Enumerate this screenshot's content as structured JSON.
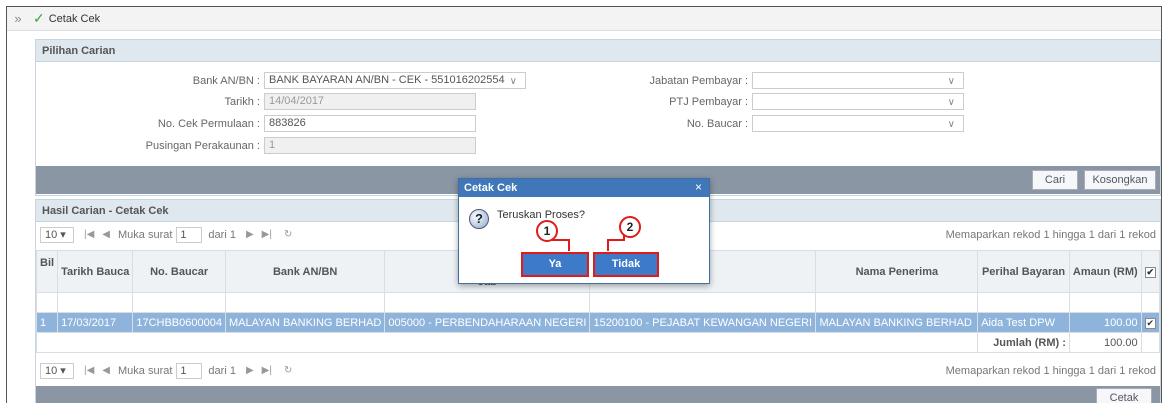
{
  "window": {
    "collapse_glyph": "»",
    "title": "Cetak Cek"
  },
  "search_panel": {
    "title": "Pilihan Carian",
    "bank_label": "Bank AN/BN :",
    "bank_value": "BANK BAYARAN AN/BN - CEK - 551016202554",
    "date_label": "Tarikh :",
    "date_value": "14/04/2017",
    "cheque_start_label": "No. Cek Permulaan :",
    "cheque_start_value": "883826",
    "cycle_label": "Pusingan Perakaunan :",
    "cycle_value": "1",
    "dept_label": "Jabatan Pembayar :",
    "dept_value": "",
    "ptj_label": "PTJ Pembayar :",
    "ptj_value": "",
    "voucher_label": "No. Baucar :",
    "voucher_value": "",
    "search_button": "Cari",
    "clear_button": "Kosongkan"
  },
  "results_panel": {
    "title": "Hasil Carian - Cetak Cek",
    "pager": {
      "page_size": "10",
      "page_label": "Muka surat",
      "page_value": "1",
      "of_label": "dari 1",
      "record_info": "Memaparkan rekod 1 hingga 1 dari 1 rekod"
    },
    "columns": [
      "Bil",
      "Tarikh Bauca",
      "No. Baucar",
      "Bank AN/BN",
      "Jab",
      "",
      "Nama Penerima",
      "Perihal Bayaran",
      "Amaun (RM)"
    ],
    "rows": [
      {
        "bil": "1",
        "tarikh": "17/03/2017",
        "no_baucar": "17CHBB0600004",
        "bank": "MALAYAN BANKING BERHAD",
        "jabatan": "005000 - PERBENDAHARAAN NEGERI",
        "ptj": "15200100 - PEJABAT KEWANGAN NEGERI",
        "penerima": "MALAYAN BANKING BERHAD",
        "perihal": "Aida Test DPW",
        "amaun": "100.00"
      }
    ],
    "total_label": "Jumlah (RM) :",
    "total_value": "100.00",
    "print_button": "Cetak"
  },
  "dialog": {
    "title": "Cetak Cek",
    "close_glyph": "×",
    "icon_glyph": "?",
    "message": "Teruskan Proses?",
    "yes_button": "Ya",
    "no_button": "Tidak"
  },
  "annotations": {
    "callout_1": "1",
    "callout_2": "2",
    "color": "#e01b1b"
  },
  "colors": {
    "accent_blue": "#3f77b8",
    "selected_row": "#8fb4dc",
    "bar_gray": "#8a96a3"
  }
}
